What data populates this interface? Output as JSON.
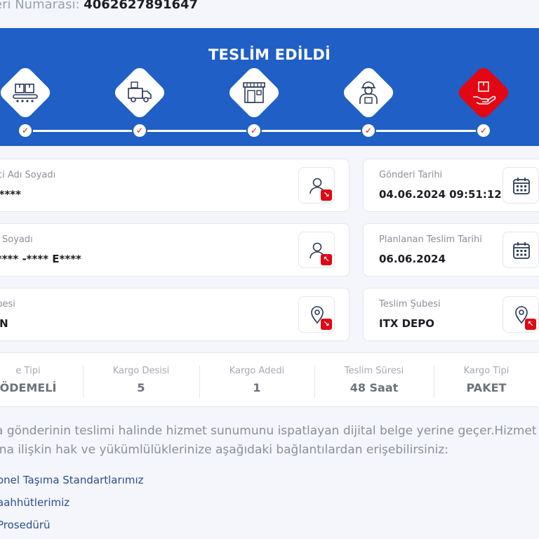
{
  "tracking": {
    "label": "eri Numarası:",
    "number": "4062627891647"
  },
  "status": {
    "title": "TESLİM EDİLDİ"
  },
  "steps": [
    {
      "icon": "warehouse-conveyor-icon"
    },
    {
      "icon": "delivery-truck-icon"
    },
    {
      "icon": "branch-store-icon"
    },
    {
      "icon": "courier-icon"
    },
    {
      "icon": "hand-package-icon",
      "active": true
    }
  ],
  "cards": {
    "sender": {
      "label": "rici Adı Soyadı",
      "value": "A****"
    },
    "send_date": {
      "label": "Gönderi Tarihi",
      "value": "04.06.2024 09:51:12"
    },
    "receiver": {
      "label": "dı Soyadı",
      "value": "***** -**** E****"
    },
    "planned_date": {
      "label": "Planlanan Teslim Tarihi",
      "value": "06.06.2024"
    },
    "origin_branch": {
      "label": "ubesi",
      "value": "UN"
    },
    "delivery_branch": {
      "label": "Teslim Şubesi",
      "value": "ITX DEPO"
    }
  },
  "info": {
    "payment": {
      "label": "e Tipi",
      "value": "ÖDEMELİ"
    },
    "desi": {
      "label": "Kargo Desisi",
      "value": "5"
    },
    "count": {
      "label": "Kargo Adedi",
      "value": "1"
    },
    "duration": {
      "label": "Teslim Süresi",
      "value": "48 Saat"
    },
    "type": {
      "label": "Kargo Tipi",
      "value": "PAKET"
    }
  },
  "notice": {
    "line1": "a gönderinin teslimi halinde hizmet sunumunu ispatlayan dijital belge yerine geçer.Hizmet",
    "line2": "ına ilişkin hak ve yükümlülüklerinize aşağıdaki bağlantılardan erişebilirsiniz:"
  },
  "links": [
    "onel Taşıma Standartlarımız",
    "aahhütlerimiz",
    "Prosedürü"
  ],
  "colors": {
    "brand_blue": "#1f5fc6",
    "accent_red": "#e30613",
    "link": "#2a4f8f"
  }
}
